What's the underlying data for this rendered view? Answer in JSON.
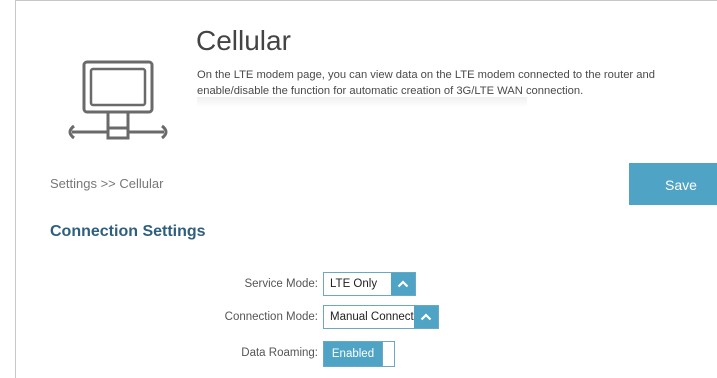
{
  "header": {
    "title": "Cellular",
    "description": "On the LTE modem page, you can view data on the LTE modem connected to the router and enable/disable the function for automatic creation of 3G/LTE WAN connection."
  },
  "breadcrumb": "Settings >> Cellular",
  "toolbar": {
    "save_label": "Save"
  },
  "section": {
    "heading": "Connection Settings"
  },
  "fields": {
    "service_mode": {
      "label": "Service Mode:",
      "value": "LTE Only"
    },
    "connection_mode": {
      "label": "Connection Mode:",
      "value": "Manual Connect"
    },
    "data_roaming": {
      "label": "Data Roaming:",
      "value": "Enabled"
    }
  },
  "colors": {
    "accent": "#4fa4c6",
    "heading": "#2f5f7f"
  },
  "icons": {
    "device": "computer-network-icon",
    "dropdown": "chevron-up-icon"
  }
}
